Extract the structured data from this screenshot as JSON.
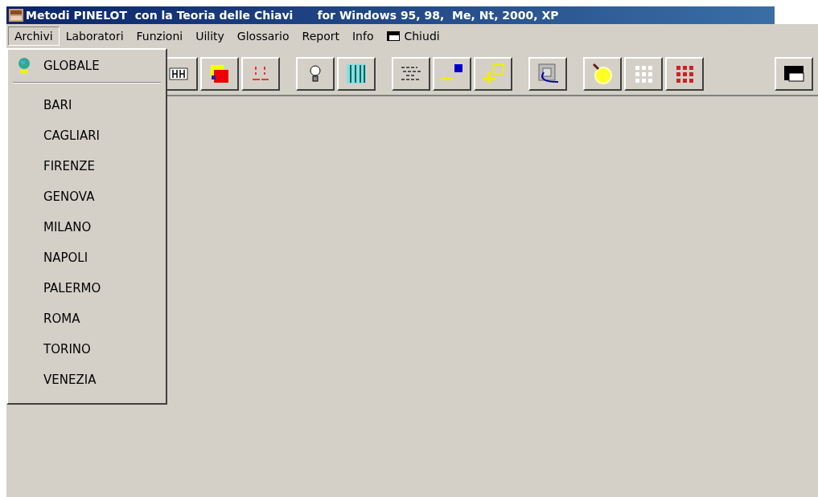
{
  "window": {
    "title": "Metodi PINELOT  con la Teoria delle Chiavi",
    "subtitle": "for Windows 95, 98,  Me, Nt, 2000, XP"
  },
  "menu": [
    {
      "label": "Archivi",
      "selected": true,
      "kind": "text"
    },
    {
      "label": "Laboratori",
      "selected": false,
      "kind": "text"
    },
    {
      "label": "Funzioni",
      "selected": false,
      "kind": "text"
    },
    {
      "label": "Uility",
      "selected": false,
      "kind": "text"
    },
    {
      "label": "Glossario",
      "selected": false,
      "kind": "text"
    },
    {
      "label": "Report",
      "selected": false,
      "kind": "text"
    },
    {
      "label": "Info",
      "selected": false,
      "kind": "text"
    },
    {
      "label": "Chiudi",
      "selected": false,
      "kind": "command"
    }
  ],
  "dropdown": {
    "items": [
      {
        "label": "GLOBALE",
        "kind": "header"
      },
      {
        "label": "BARI",
        "kind": "item"
      },
      {
        "label": "CAGLIARI",
        "kind": "item"
      },
      {
        "label": "FIRENZE",
        "kind": "item"
      },
      {
        "label": "GENOVA",
        "kind": "item"
      },
      {
        "label": "MILANO",
        "kind": "item"
      },
      {
        "label": "NAPOLI",
        "kind": "item"
      },
      {
        "label": "PALERMO",
        "kind": "item"
      },
      {
        "label": "ROMA",
        "kind": "item"
      },
      {
        "label": "TORINO",
        "kind": "item"
      },
      {
        "label": "VENEZIA",
        "kind": "item"
      }
    ]
  }
}
